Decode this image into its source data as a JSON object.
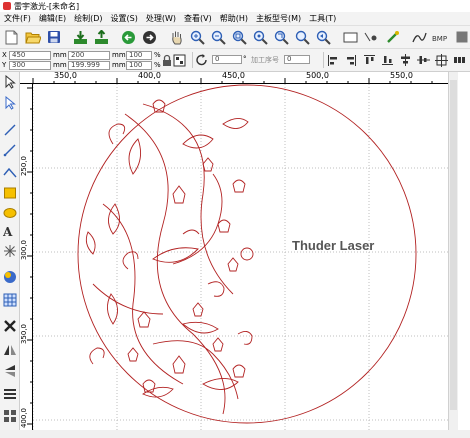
{
  "window": {
    "title": "雷宇激光-[未命名]"
  },
  "menu": [
    "文件(F)",
    "编辑(E)",
    "绘制(D)",
    "设置(S)",
    "处理(W)",
    "查看(V)",
    "帮助(H)",
    "主板型号(M)",
    "工具(T)"
  ],
  "position": {
    "x_label": "X",
    "x_value": "450",
    "y_label": "Y",
    "y_value": "300",
    "unit1": "mm",
    "unit2": "mm"
  },
  "size": {
    "w_value": "200",
    "h_value": "199.999",
    "unit1": "mm",
    "unit2": "mm"
  },
  "scale": {
    "w_percent": "100",
    "h_percent": "100",
    "unit": "%"
  },
  "rotation": {
    "value": "0",
    "unit": "°"
  },
  "process_no": {
    "label": "加工序号",
    "value": "0"
  },
  "ruler": {
    "h_ticks": [
      "350,0",
      "400,0",
      "450,0",
      "500,0",
      "550,0"
    ],
    "v_ticks": [
      "250,0",
      "300,0",
      "350,0",
      "400,0"
    ]
  },
  "canvas": {
    "text": "Thuder Laser",
    "line_color": "#b22222"
  }
}
